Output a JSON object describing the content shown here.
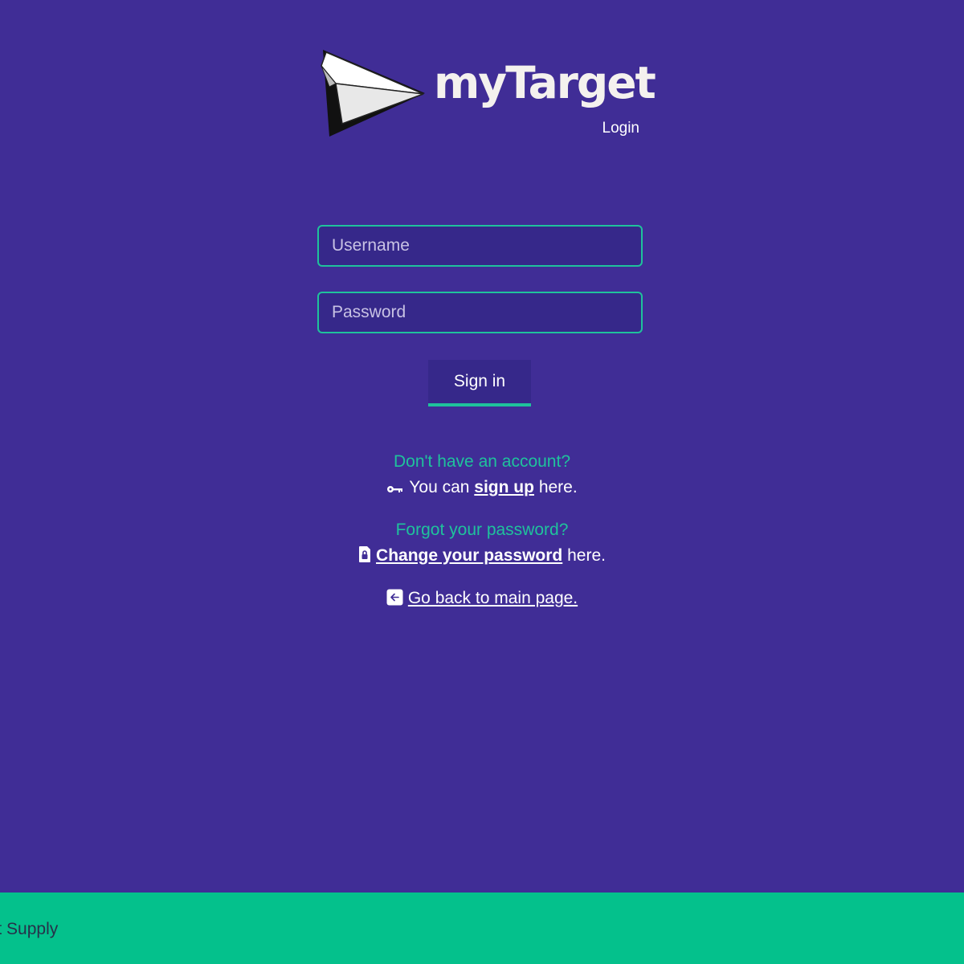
{
  "brand": {
    "name": "myTarget",
    "subtitle": "Login"
  },
  "form": {
    "username_placeholder": "Username",
    "password_placeholder": "Password",
    "signin_label": "Sign in"
  },
  "signup": {
    "question": "Don't have an account?",
    "prefix": "You can",
    "link_text": "sign up",
    "suffix": "here.",
    "icon": "key-icon"
  },
  "forgot": {
    "question": "Forgot your password?",
    "link_text": "Change your password",
    "suffix": "here.",
    "icon": "lock-document-icon"
  },
  "back": {
    "link_text": "Go back to main page.",
    "icon": "arrow-left-icon"
  },
  "footer": {
    "text": "get Supply"
  },
  "colors": {
    "background": "#402d96",
    "accent": "#1fc29c",
    "footer": "#04c18c",
    "input_bg": "#36288a"
  }
}
